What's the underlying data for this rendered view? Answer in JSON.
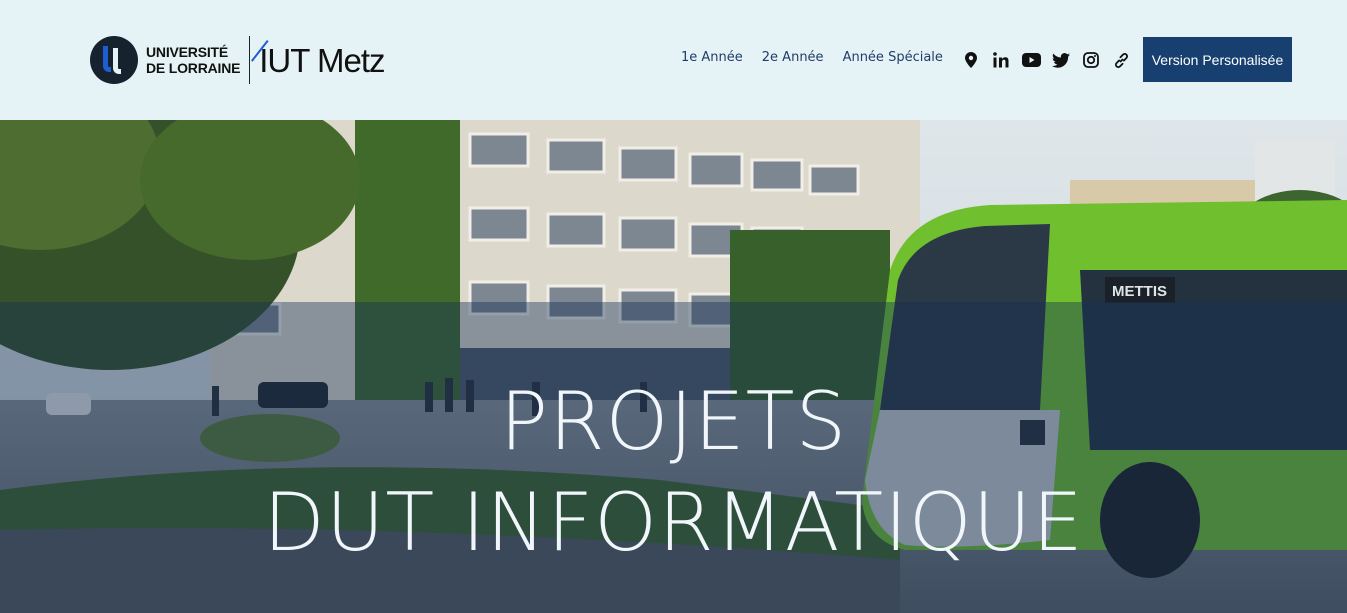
{
  "header": {
    "university_line1": "UNIVERSITÉ",
    "university_line2": "DE LORRAINE",
    "iut_logo": "IUT Metz",
    "nav": [
      {
        "label": "1e Année"
      },
      {
        "label": "2e Année"
      },
      {
        "label": "Année Spéciale"
      }
    ],
    "social_icons": [
      "location-pin-icon",
      "linkedin-icon",
      "youtube-icon",
      "twitter-icon",
      "instagram-icon",
      "link-icon"
    ],
    "cta_label": "Version Personalisée"
  },
  "hero": {
    "title_line1": "PROJETS",
    "title_line2": "DUT INFORMATIQUE",
    "bus_sign": "METTIS"
  },
  "colors": {
    "header_bg": "#e6f3f6",
    "nav_text": "#1f3d6a",
    "cta_bg": "#173f6f",
    "overlay": "rgba(22, 48, 86, 0.42)"
  }
}
